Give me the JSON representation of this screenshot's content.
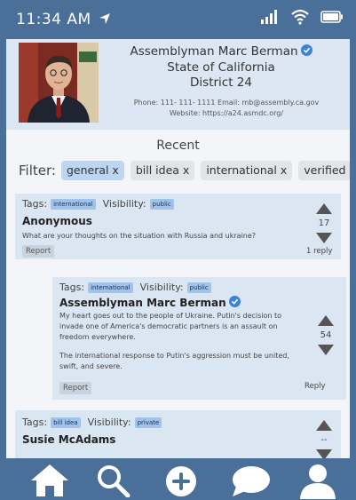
{
  "status": {
    "time": "11:34 AM"
  },
  "profile": {
    "name": "Assemblyman Marc Berman",
    "state": "State of California",
    "district": "District 24",
    "phone_line": "Phone: 111- 111- 1111   Email: mb@assembly.ca.gov",
    "website_line": "Website: https://a24.asmdc.org/"
  },
  "feed": {
    "title": "Recent",
    "filter_label": "Filter:",
    "filters": [
      "general x",
      "bill idea x",
      "international x",
      "verified x"
    ]
  },
  "labels": {
    "tags": "Tags:",
    "visibility": "Visibility:"
  },
  "posts": [
    {
      "tag": "international",
      "visibility": "public",
      "author": "Anonymous",
      "body": "What are your thoughts on the situation with Russia and ukraine?",
      "report": "Report",
      "votes": "17",
      "replies": "1 reply"
    },
    {
      "tag": "international",
      "visibility": "public",
      "author": "Assemblyman Marc Berman",
      "body_p1": "My heart goes out to the people of Ukraine. Putin's decision to invade one of America's democratic partners is an assault on freedom everywhere.",
      "body_p2": "The international response to Putin's aggression must be united, swift, and severe.",
      "report": "Report",
      "votes": "54",
      "reply": "Reply"
    },
    {
      "tag": "bill idea",
      "visibility": "private",
      "author": "Susie McAdams",
      "votes": "--"
    }
  ],
  "nav": {
    "icons": [
      "home-icon",
      "search-icon",
      "add-icon",
      "chat-icon",
      "profile-icon"
    ]
  },
  "colors": {
    "frame": "#4a6f99",
    "card": "#dbe6f3",
    "tag": "#9fc3ec",
    "active_filter": "#bcd6f2",
    "verified": "#3c83d6"
  }
}
